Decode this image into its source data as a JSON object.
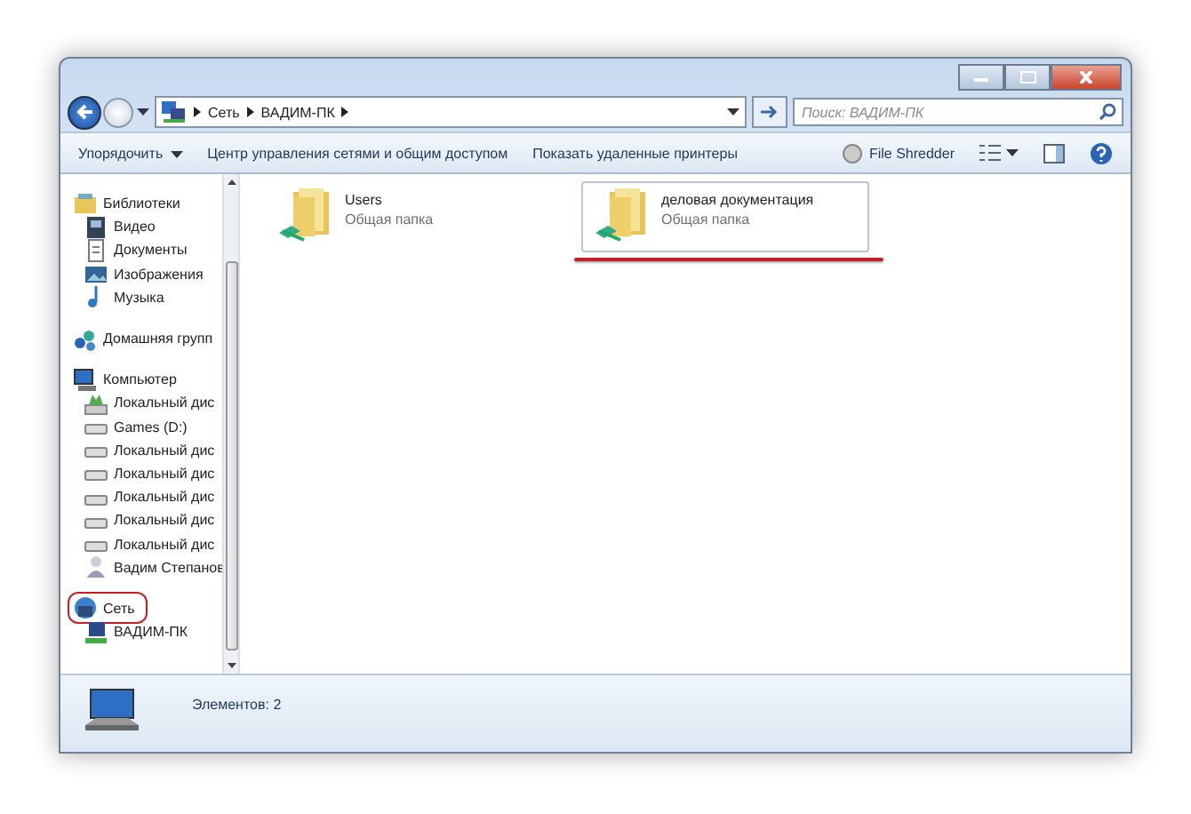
{
  "address_bar": {
    "crumbs": [
      "Сеть",
      "ВАДИМ-ПК"
    ]
  },
  "search": {
    "placeholder": "Поиск: ВАДИМ-ПК"
  },
  "toolbar": {
    "items": [
      {
        "label": "Упорядочить",
        "dropdown": true
      },
      {
        "label": "Центр управления сетями и общим доступом",
        "dropdown": false
      },
      {
        "label": "Показать удаленные принтеры",
        "dropdown": false
      }
    ],
    "plugin": "File Shredder"
  },
  "sidebar": {
    "groups": [
      {
        "label": "Библиотеки",
        "kind": "library",
        "marked": false,
        "children": [
          {
            "label": "Видео",
            "kind": "video",
            "marked": false
          },
          {
            "label": "Документы",
            "kind": "documents",
            "marked": false
          },
          {
            "label": "Изображения",
            "kind": "images",
            "marked": false
          },
          {
            "label": "Музыка",
            "kind": "music",
            "marked": false
          }
        ]
      },
      {
        "label": "Домашняя групп",
        "kind": "homegroup",
        "marked": false
      },
      {
        "label": "Компьютер",
        "kind": "computer",
        "marked": false,
        "children": [
          {
            "label": "Локальный дис",
            "kind": "system-drive",
            "marked": false
          },
          {
            "label": "Games (D:)",
            "kind": "drive",
            "marked": false
          },
          {
            "label": "Локальный дис",
            "kind": "drive",
            "marked": false
          },
          {
            "label": "Локальный дис",
            "kind": "drive",
            "marked": false
          },
          {
            "label": "Локальный дис",
            "kind": "drive",
            "marked": false
          },
          {
            "label": "Локальный дис",
            "kind": "drive",
            "marked": false
          },
          {
            "label": "Локальный дис",
            "kind": "drive",
            "marked": false
          },
          {
            "label": "Вадим Степанов",
            "kind": "user",
            "marked": false
          }
        ]
      },
      {
        "label": "Сеть",
        "kind": "network",
        "marked": true,
        "children": [
          {
            "label": "ВАДИМ-ПК",
            "kind": "pc",
            "marked": false
          }
        ]
      }
    ]
  },
  "items": [
    {
      "name": "Users",
      "type": "Общая папка",
      "selected": false,
      "marked": false
    },
    {
      "name": "деловая документация",
      "type": "Общая папка",
      "selected": true,
      "marked": true
    }
  ],
  "status_bar": {
    "text": "Элементов: 2"
  }
}
